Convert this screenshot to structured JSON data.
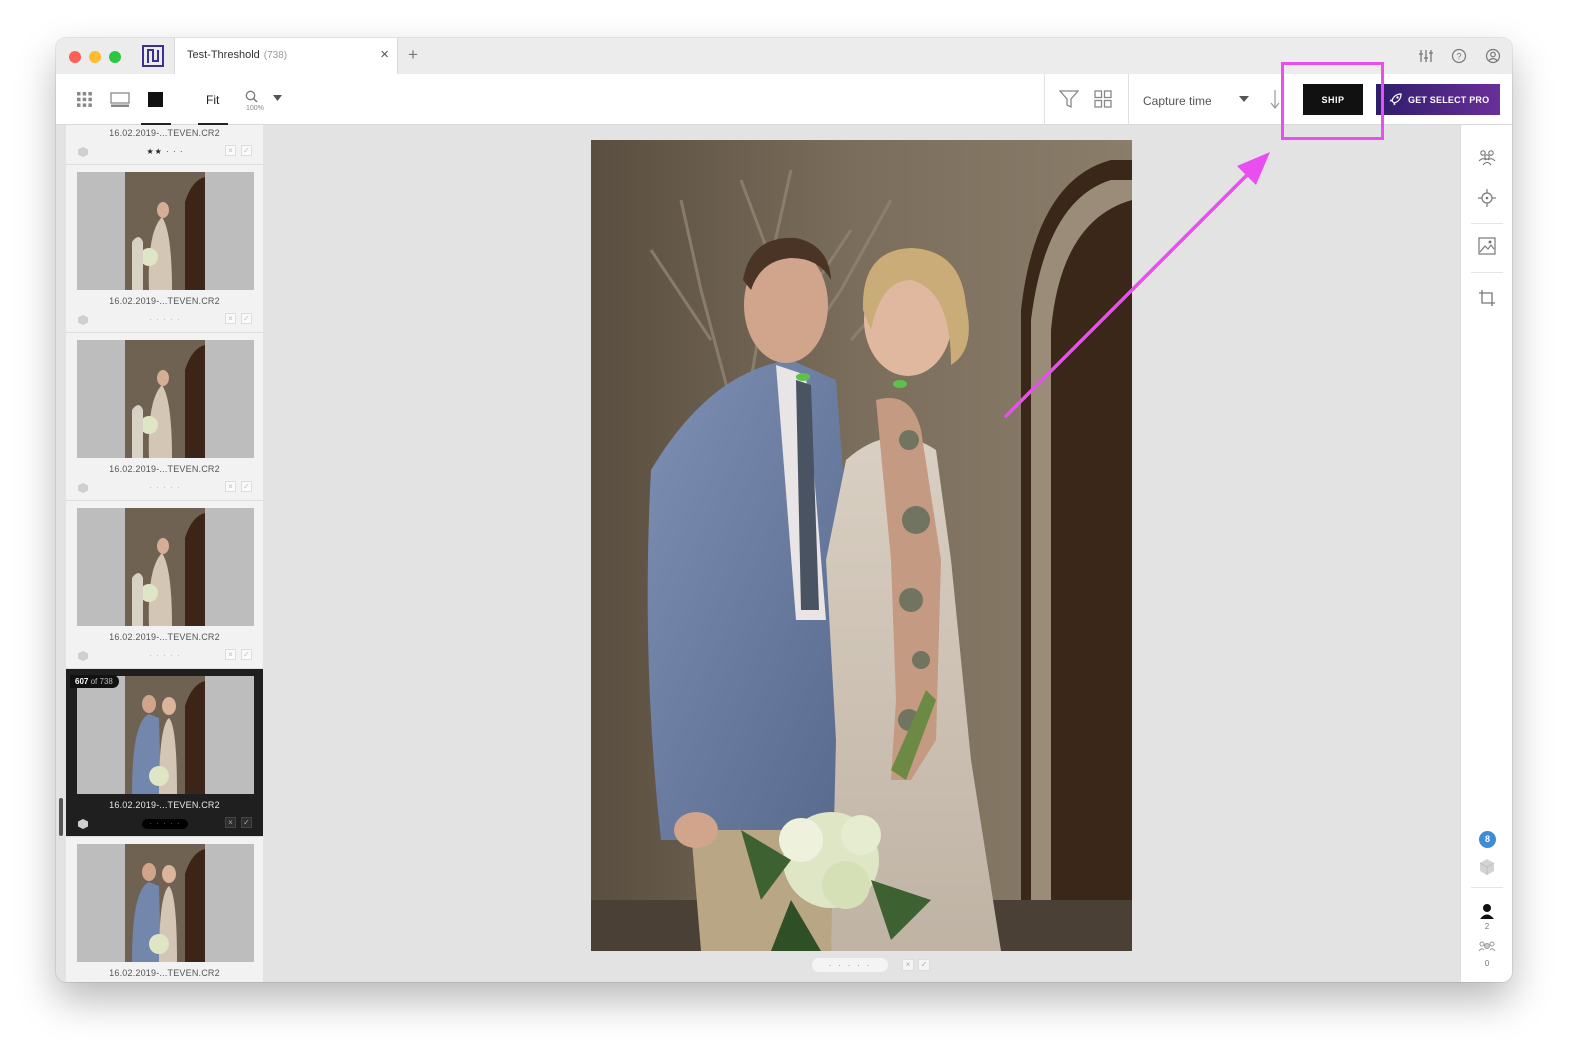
{
  "titlebar": {
    "tab_title": "Test-Threshold",
    "tab_count": "(738)",
    "tab_close": "×",
    "new_tab": "+"
  },
  "toolbar": {
    "fit_label": "Fit",
    "zoom_percent": "100%",
    "sort_label": "Capture time",
    "ship_label": "SHIP",
    "pro_label": "GET SELECT PRO"
  },
  "filmstrip": {
    "position_badge": {
      "current": "607",
      "of_label": "of 738"
    },
    "cards": [
      {
        "filename": "16.02.2019-...TEVEN.CR2",
        "rating": "★★ · · ·",
        "photo": "bride",
        "selected": false
      },
      {
        "filename": "16.02.2019-...TEVEN.CR2",
        "rating": "· · · · ·",
        "photo": "bride",
        "selected": false
      },
      {
        "filename": "16.02.2019-...TEVEN.CR2",
        "rating": "· · · · ·",
        "photo": "bride",
        "selected": false
      },
      {
        "filename": "16.02.2019-...TEVEN.CR2",
        "rating": "· · · · ·",
        "photo": "bride",
        "selected": false
      },
      {
        "filename": "16.02.2019-...TEVEN.CR2",
        "rating": "· · · · ·",
        "photo": "couple",
        "selected": true
      },
      {
        "filename": "16.02.2019-...TEVEN.CR2",
        "rating": "",
        "photo": "couple",
        "selected": false
      }
    ],
    "reject_label": "×",
    "accept_label": "✓"
  },
  "viewer": {
    "rating_dots": "· · · · ·",
    "reject_label": "×",
    "accept_label": "✓"
  },
  "right_panel": {
    "notification_count": "8",
    "person_count": "2",
    "group_count": "0"
  },
  "colors": {
    "accent_highlight": "#e84ef0",
    "ship_bg": "#111111",
    "pro_gradient_start": "#2e1d6b",
    "pro_gradient_end": "#6a2f9a",
    "notification_blue": "#3d8bd9"
  },
  "icons": {
    "traffic_lights": [
      "close-dot",
      "minimize-dot",
      "maximize-dot"
    ],
    "titlebar_right": [
      "sliders-icon",
      "help-icon",
      "account-icon"
    ],
    "toolbar_left": [
      "grid-view-icon",
      "compare-view-icon",
      "single-view-icon",
      "zoom-icon",
      "caret-down-icon"
    ],
    "toolbar_right": [
      "filter-icon",
      "layout-icon",
      "sort-caret-icon",
      "sort-direction-icon",
      "rocket-icon"
    ],
    "right_panel": [
      "people-icon",
      "focus-icon",
      "image-adjust-icon",
      "crop-icon",
      "cube-icon",
      "person-icon",
      "group-icon"
    ]
  }
}
